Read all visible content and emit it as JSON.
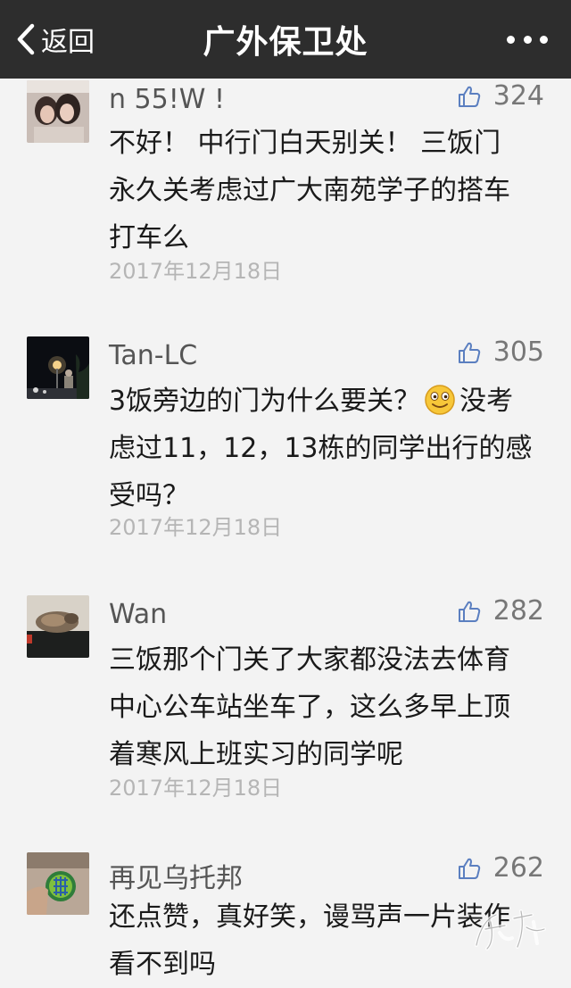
{
  "nav": {
    "back_label": "返回",
    "title": "广外保卫处"
  },
  "comments": [
    {
      "name": "n 55!W !",
      "likes": "324",
      "lines": [
        "不好！ 中行门白天别关！ 三饭门",
        "永久关考虑过广大南苑学子的搭车",
        "打车么"
      ],
      "date": "2017年12月18日"
    },
    {
      "name": "Tan-LC",
      "likes": "305",
      "lines": [
        "3饭旁边的门为什么要关？",
        "没考",
        "虑过11，12，13栋的同学出行的感",
        "受吗？"
      ],
      "date": "2017年12月18日"
    },
    {
      "name": "Wan",
      "likes": "282",
      "lines": [
        "三饭那个门关了大家都没法去体育",
        "中心公车站坐车了，这么多早上顶",
        "着寒风上班实习的同学呢"
      ],
      "date": "2017年12月18日"
    },
    {
      "name": "再见乌托邦",
      "likes": "262",
      "lines": [
        "还点赞，真好笑，谩骂声一片装作",
        "看不到吗"
      ]
    }
  ],
  "icons": {
    "back": "chevron-left-icon",
    "more": "more-dots-icon",
    "like": "thumbs-up-icon",
    "emoji": "smiley-emoji-icon"
  },
  "colors": {
    "header_bg": "#2d2d2d",
    "page_bg": "#f3f3f3",
    "name": "#555555",
    "date": "#b5b5b5"
  }
}
